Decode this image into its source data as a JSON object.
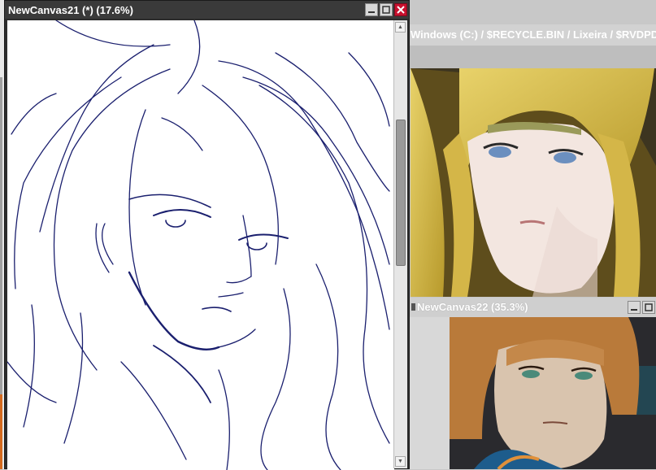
{
  "canvas_window": {
    "title": "NewCanvas21 (*) (17.6%)",
    "buttons": {
      "minimize": "minimize-icon",
      "maximize": "maximize-icon",
      "close": "close-icon"
    }
  },
  "explorer": {
    "path": "Windows (C:) / $RECYCLE.BIN / Lixeira / $RVDPDG"
  },
  "canvas_window_2": {
    "title": "NewCanvas22 (35.3%)"
  },
  "colors": {
    "titlebar_dark": "#3a3a3a",
    "close_button": "#c8102e",
    "line_art": "#1a1f6e",
    "scroll_accent": "#d46a1e"
  }
}
